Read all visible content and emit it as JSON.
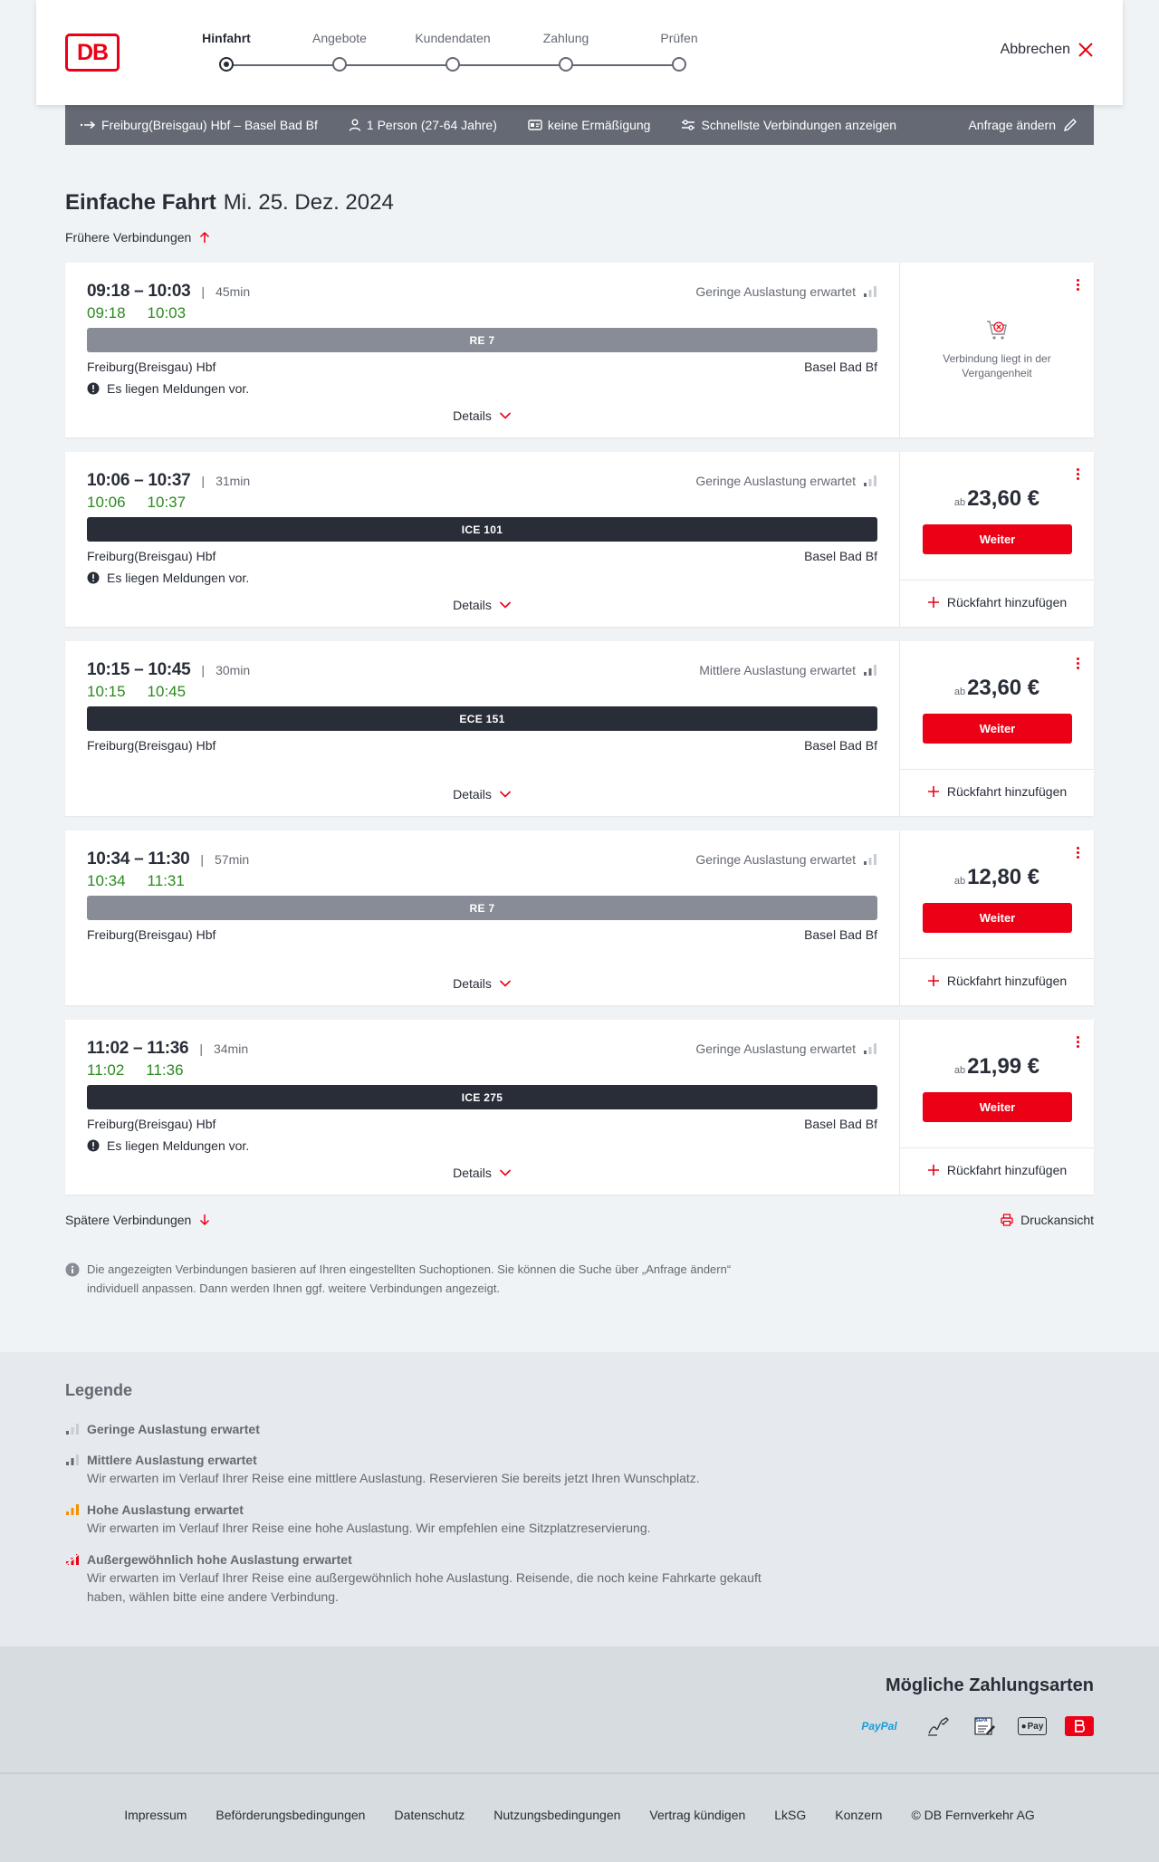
{
  "header": {
    "logo_text": "DB",
    "steps": [
      {
        "label": "Hinfahrt",
        "active": true
      },
      {
        "label": "Angebote",
        "active": false
      },
      {
        "label": "Kundendaten",
        "active": false
      },
      {
        "label": "Zahlung",
        "active": false
      },
      {
        "label": "Prüfen",
        "active": false
      }
    ],
    "cancel_label": "Abbrechen"
  },
  "summary": {
    "route": "Freiburg(Breisgau) Hbf – Basel Bad Bf",
    "travellers": "1 Person (27-64 Jahre)",
    "discount": "keine Ermäßigung",
    "fastest": "Schnellste Verbindungen anzeigen",
    "edit": "Anfrage ändern"
  },
  "main": {
    "title_bold": "Einfache Fahrt",
    "title_date": "Mi. 25. Dez. 2024",
    "earlier_label": "Frühere Verbindungen",
    "later_label": "Spätere Verbindungen",
    "print_label": "Druckansicht",
    "info_note": "Die angezeigten Verbindungen basieren auf Ihren eingestellten Suchoptionen. Sie können die Suche über „Anfrage ändern“ individuell anpassen. Dann werden Ihnen ggf. weitere Verbindungen angezeigt."
  },
  "connections": [
    {
      "times": "09:18 – 10:03",
      "duration": "45min",
      "occupancy": "Geringe Auslastung erwartet",
      "dep_realtime": "09:18",
      "arr_realtime": "10:03",
      "train": "RE 7",
      "train_kind": "regional",
      "from": "Freiburg(Breisgau) Hbf",
      "to": "Basel Bad Bf",
      "message": "Es liegen Meldungen vor.",
      "details_label": "Details",
      "past": true,
      "past_label": "Verbindung liegt in der Vergangenheit"
    },
    {
      "times": "10:06 – 10:37",
      "duration": "31min",
      "occupancy": "Geringe Auslastung erwartet",
      "dep_realtime": "10:06",
      "arr_realtime": "10:37",
      "train": "ICE 101",
      "train_kind": "long",
      "from": "Freiburg(Breisgau) Hbf",
      "to": "Basel Bad Bf",
      "message": "Es liegen Meldungen vor.",
      "details_label": "Details",
      "past": false,
      "price_prefix": "ab",
      "price": "23,60 €",
      "button_label": "Weiter",
      "return_label": "Rückfahrt hinzufügen"
    },
    {
      "times": "10:15 – 10:45",
      "duration": "30min",
      "occupancy": "Mittlere Auslastung erwartet",
      "dep_realtime": "10:15",
      "arr_realtime": "10:45",
      "train": "ECE 151",
      "train_kind": "long",
      "from": "Freiburg(Breisgau) Hbf",
      "to": "Basel Bad Bf",
      "message": "",
      "details_label": "Details",
      "past": false,
      "price_prefix": "ab",
      "price": "23,60 €",
      "button_label": "Weiter",
      "return_label": "Rückfahrt hinzufügen"
    },
    {
      "times": "10:34 – 11:30",
      "duration": "57min",
      "occupancy": "Geringe Auslastung erwartet",
      "dep_realtime": "10:34",
      "arr_realtime": "11:31",
      "train": "RE 7",
      "train_kind": "regional",
      "from": "Freiburg(Breisgau) Hbf",
      "to": "Basel Bad Bf",
      "message": "",
      "details_label": "Details",
      "past": false,
      "price_prefix": "ab",
      "price": "12,80 €",
      "button_label": "Weiter",
      "return_label": "Rückfahrt hinzufügen"
    },
    {
      "times": "11:02 – 11:36",
      "duration": "34min",
      "occupancy": "Geringe Auslastung erwartet",
      "dep_realtime": "11:02",
      "arr_realtime": "11:36",
      "train": "ICE 275",
      "train_kind": "long",
      "from": "Freiburg(Breisgau) Hbf",
      "to": "Basel Bad Bf",
      "message": "Es liegen Meldungen vor.",
      "details_label": "Details",
      "past": false,
      "price_prefix": "ab",
      "price": "21,99 €",
      "button_label": "Weiter",
      "return_label": "Rückfahrt hinzufügen"
    }
  ],
  "legend": {
    "title": "Legende",
    "items": [
      {
        "title": "Geringe Auslastung erwartet",
        "desc": "",
        "icon": "occupancy-low-icon",
        "color": "#646973"
      },
      {
        "title": "Mittlere Auslastung erwartet",
        "desc": "Wir erwarten im Verlauf Ihrer Reise eine mittlere Auslastung. Reservieren Sie bereits jetzt Ihren Wunschplatz.",
        "icon": "occupancy-medium-icon",
        "color": "#646973"
      },
      {
        "title": "Hohe Auslastung erwartet",
        "desc": "Wir erwarten im Verlauf Ihrer Reise eine hohe Auslastung. Wir empfehlen eine Sitzplatzreservierung.",
        "icon": "occupancy-high-icon",
        "color": "#f39200"
      },
      {
        "title": "Außergewöhnlich hohe Auslastung erwartet",
        "desc": "Wir erwarten im Verlauf Ihrer Reise eine außergewöhnlich hohe Auslastung. Reisende, die noch keine Fahrkarte gekauft haben, wählen bitte eine andere Verbindung.",
        "icon": "occupancy-exceptional-icon",
        "color": "#ec0016"
      }
    ]
  },
  "payment": {
    "title": "Mögliche Zahlungsarten",
    "paypal_a": "Pay",
    "paypal_b": "Pal",
    "sepa": "SEPA",
    "applepay": "Pay"
  },
  "footer": {
    "links": [
      "Impressum",
      "Beförderungsbedingungen",
      "Datenschutz",
      "Nutzungsbedingungen",
      "Vertrag kündigen",
      "LkSG",
      "Konzern",
      "© DB Fernverkehr AG"
    ]
  },
  "colors": {
    "accent": "#ec0016",
    "realtime_green": "#2b8a1e",
    "long_distance_bar": "#282d37",
    "regional_bar": "#878c96",
    "summary_bar": "#646973"
  }
}
